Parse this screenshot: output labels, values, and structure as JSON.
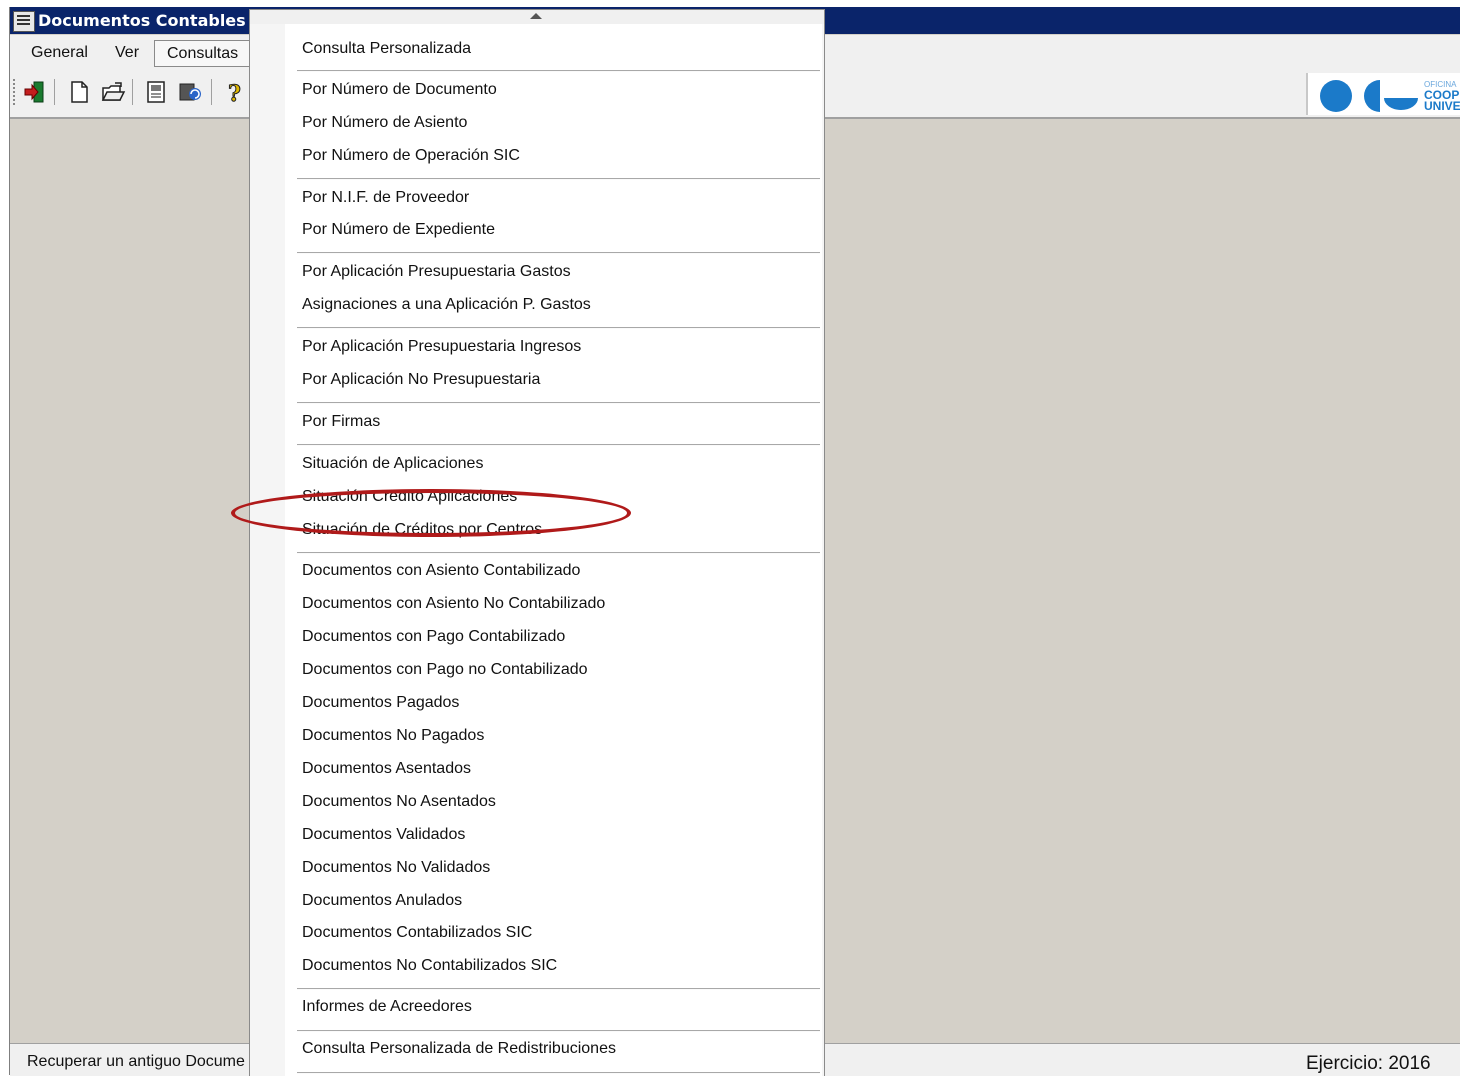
{
  "window": {
    "title": "Documentos Contables"
  },
  "menubar": {
    "items": [
      "General",
      "Ver",
      "Consultas"
    ]
  },
  "toolbar": {
    "buttons": [
      "exit-icon",
      "new-document-icon",
      "open-folder-icon",
      "report-icon",
      "refresh-icon",
      "help-icon"
    ]
  },
  "logo": {
    "line1": "OFICINA",
    "line2": "COOP",
    "line3": "UNIVE"
  },
  "dropdown": {
    "items": [
      "Consulta Personalizada",
      "Por Número de Documento",
      "Por Número de Asiento",
      "Por Número de Operación SIC",
      "Por N.I.F. de Proveedor",
      "Por Número de Expediente",
      "Por Aplicación Presupuestaria Gastos",
      "Asignaciones a una Aplicación P. Gastos",
      "Por Aplicación Presupuestaria Ingresos",
      "Por Aplicación No Presupuestaria",
      "Por Firmas",
      "Situación de Aplicaciones",
      "Situación Crédito Aplicaciones",
      "Situación de Créditos por Centros",
      "Documentos con Asiento Contabilizado",
      "Documentos con Asiento No Contabilizado",
      "Documentos con Pago Contabilizado",
      "Documentos con Pago no Contabilizado",
      "Documentos Pagados",
      "Documentos No Pagados",
      "Documentos Asentados",
      "Documentos No Asentados",
      "Documentos Validados",
      "Documentos No Validados",
      "Documentos Anulados",
      "Documentos Contabilizados SIC",
      "Documentos No Contabilizados SIC",
      "Informes de Acreedores",
      "Consulta Personalizada de Redistribuciones"
    ],
    "highlighted": "Situación de Créditos por Centros"
  },
  "statusbar": {
    "left": "Recuperar un antiguo Docume",
    "right": "Ejercicio: 2016"
  },
  "colors": {
    "titlebar": "#0a246a",
    "annotation": "#b01a1a",
    "logo": "#1b7ac9"
  }
}
